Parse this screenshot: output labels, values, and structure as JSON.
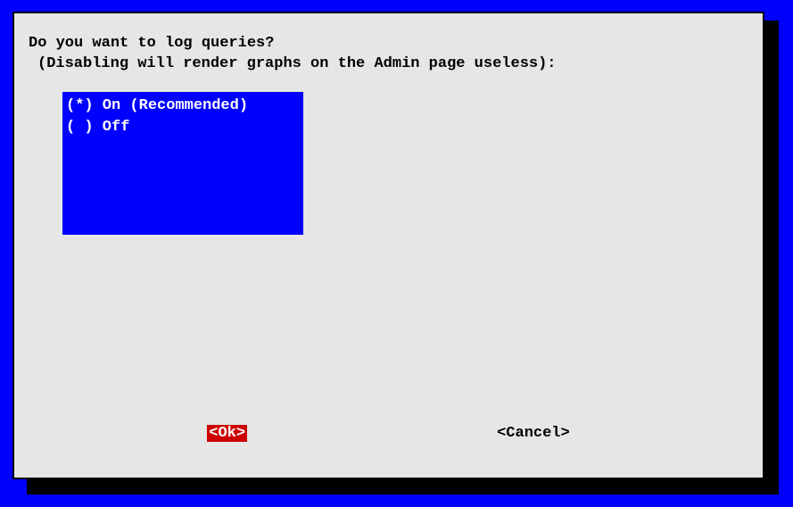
{
  "prompt": {
    "line1": "Do you want to log queries?",
    "line2": "(Disabling will render graphs on the Admin page useless):"
  },
  "options": [
    {
      "selected": true,
      "label": "On (Recommended)",
      "display": "(*) On (Recommended)"
    },
    {
      "selected": false,
      "label": "Off",
      "display": "( ) Off"
    }
  ],
  "buttons": {
    "ok": "<Ok>",
    "cancel": "<Cancel>"
  },
  "colors": {
    "background": "#0000ff",
    "dialog_bg": "#e6e6e6",
    "highlight": "#cc0000",
    "option_box": "#0000ff",
    "shadow": "#000000"
  }
}
